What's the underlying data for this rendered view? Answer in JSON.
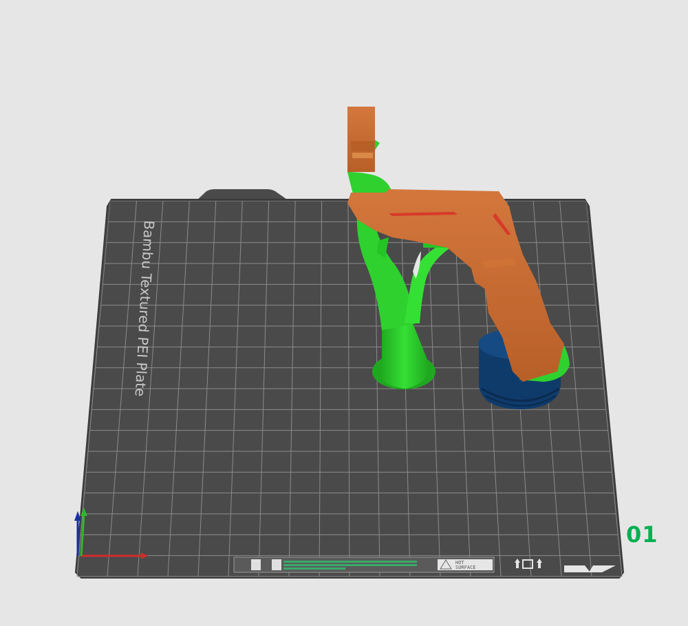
{
  "viewport": {
    "background_color": "#e6e6e6"
  },
  "build_plate": {
    "label": "Bambu Textured PEI Plate",
    "surface_color": "#4a4a4a",
    "grid_color": "#8c8c8c",
    "plate_number": "01",
    "plate_number_color": "#00b050",
    "warning_text_line1": "HOT",
    "warning_text_line2": "SURFACE"
  },
  "model": {
    "part_color": "#c8692f",
    "support_color": "#2fd12f",
    "base_color": "#0f3b6b"
  },
  "axes": {
    "x_color": "#d42a2a",
    "y_color": "#2fb82f",
    "z_color": "#1a2fa0"
  }
}
